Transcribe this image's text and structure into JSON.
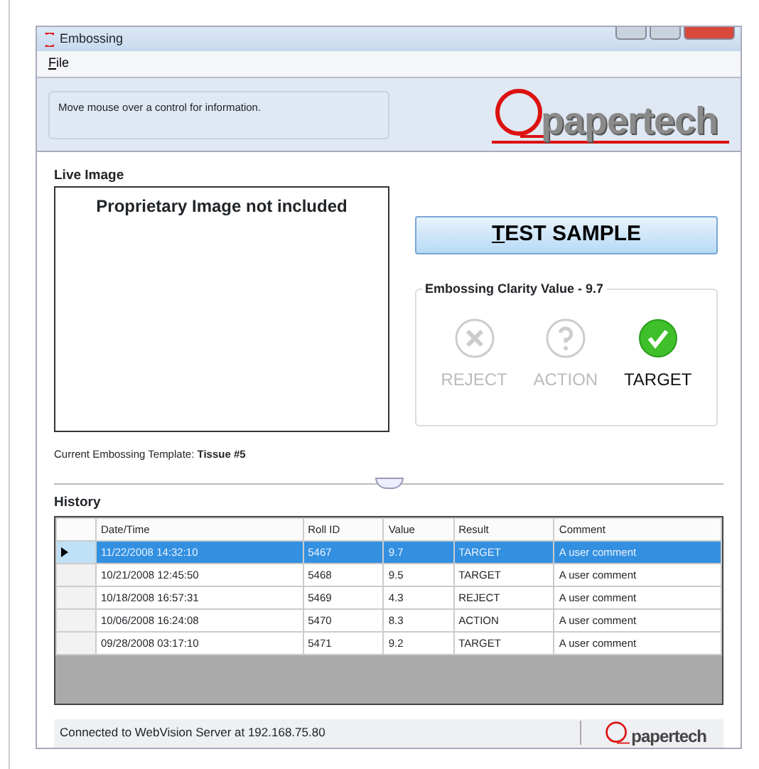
{
  "window": {
    "title": "Embossing"
  },
  "menu": [
    {
      "label": "File",
      "mnemonic_underlined": true
    }
  ],
  "info_panel": {
    "message": "Move mouse over a control for information.",
    "logo": "papertech"
  },
  "live_image": {
    "heading": "Live Image",
    "note": "Proprietary Image not included"
  },
  "template": {
    "label": "Current Embossing Template:",
    "value": "Tissue #5"
  },
  "test_button": {
    "label": "TEST SAMPLE"
  },
  "clarity": {
    "title": "Embossing Clarity Value - 9.7",
    "results": [
      {
        "kind": "reject",
        "label": "REJECT",
        "selected": false
      },
      {
        "kind": "action",
        "label": "ACTION",
        "selected": false
      },
      {
        "kind": "target",
        "label": "TARGET",
        "selected": true
      }
    ]
  },
  "history": {
    "heading": "History",
    "columns": [
      "Date/Time",
      "Roll ID",
      "Value",
      "Result",
      "Comment"
    ],
    "rows": [
      {
        "cells": [
          "11/22/2008  14:32:10",
          "5467",
          "9.7",
          "TARGET",
          "A user comment"
        ],
        "selected": true
      },
      {
        "cells": [
          "10/21/2008  12:45:50",
          "5468",
          "9.5",
          "TARGET",
          "A user comment"
        ],
        "selected": false
      },
      {
        "cells": [
          "10/18/2008  16:57:31",
          "5469",
          "4.3",
          "REJECT",
          "A user comment"
        ],
        "selected": false
      },
      {
        "cells": [
          "10/06/2008  16:24:08",
          "5470",
          "8.3",
          "ACTION",
          "A user comment"
        ],
        "selected": false
      },
      {
        "cells": [
          "09/28/2008  03:17:10",
          "5471",
          "9.2",
          "TARGET",
          "A user comment"
        ],
        "selected": false
      }
    ]
  },
  "status_bar": {
    "message": "Connected to WebVision Server at 192.168.75.80",
    "logo": "papertech"
  }
}
